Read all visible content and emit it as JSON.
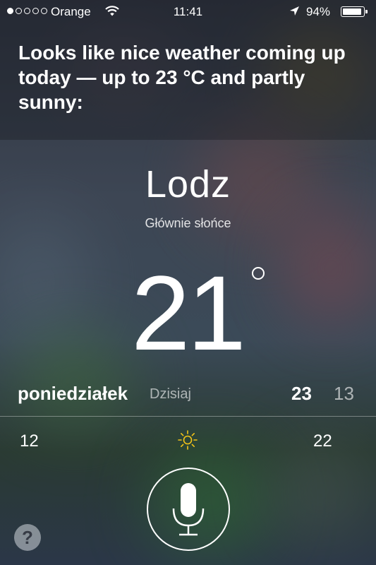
{
  "status_bar": {
    "carrier": "Orange",
    "time": "11:41",
    "battery_percent": "94%",
    "signal_strength": 1,
    "signal_max": 5,
    "battery_level": 0.94
  },
  "siri": {
    "response": "Looks like nice weather coming up today — up to 23 °C and partly sunny:"
  },
  "weather": {
    "city": "Lodz",
    "condition": "Głównie słońce",
    "temperature": "21",
    "day": "poniedziałek",
    "today_label": "Dzisiaj",
    "high": "23",
    "low": "13",
    "hour_left": "12",
    "hour_right": "22",
    "hour_icon": "sun-icon"
  },
  "controls": {
    "mic_icon": "microphone-icon",
    "help_label": "?"
  },
  "colors": {
    "sun": "#f5c518"
  }
}
